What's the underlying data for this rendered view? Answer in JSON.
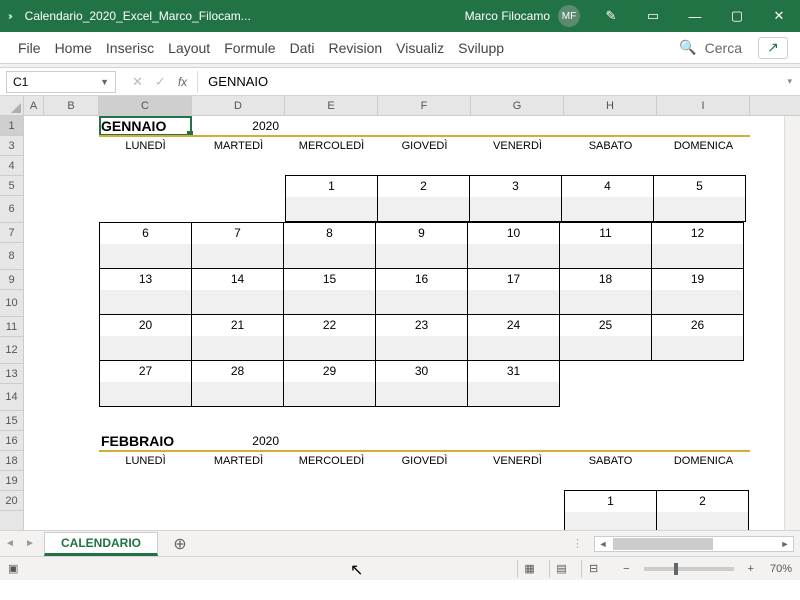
{
  "titlebar": {
    "chevrons": "››",
    "docname": "Calendario_2020_Excel_Marco_Filocam...",
    "user": "Marco Filocamo",
    "avatar": "MF"
  },
  "ribbon": {
    "tabs": [
      "File",
      "Home",
      "Inserisc",
      "Layout",
      "Formule",
      "Dati",
      "Revision",
      "Visualiz",
      "Svilupp"
    ],
    "search": "Cerca"
  },
  "formulabar": {
    "cellref": "C1",
    "value": "GENNAIO"
  },
  "columns": [
    "A",
    "B",
    "C",
    "D",
    "E",
    "F",
    "G",
    "H",
    "I"
  ],
  "rows": [
    "1",
    "3",
    "4",
    "5",
    "6",
    "7",
    "8",
    "9",
    "10",
    "11",
    "12",
    "13",
    "14",
    "15",
    "16",
    "18",
    "19",
    "20"
  ],
  "calendar": {
    "month1": "GENNAIO",
    "month2": "FEBBRAIO",
    "year": "2020",
    "dayheaders": [
      "LUNEDÌ",
      "MARTEDÌ",
      "MERCOLEDÌ",
      "GIOVEDÌ",
      "VENERDÌ",
      "SABATO",
      "DOMENICA"
    ],
    "jan": [
      [
        "",
        "",
        "1",
        "2",
        "3",
        "4",
        "5"
      ],
      [
        "6",
        "7",
        "8",
        "9",
        "10",
        "11",
        "12"
      ],
      [
        "13",
        "14",
        "15",
        "16",
        "17",
        "18",
        "19"
      ],
      [
        "20",
        "21",
        "22",
        "23",
        "24",
        "25",
        "26"
      ],
      [
        "27",
        "28",
        "29",
        "30",
        "31",
        "",
        ""
      ]
    ],
    "feb": [
      [
        "",
        "",
        "",
        "",
        "",
        "1",
        "2"
      ]
    ]
  },
  "sheettab": "CALENDARIO",
  "zoom": "70%"
}
